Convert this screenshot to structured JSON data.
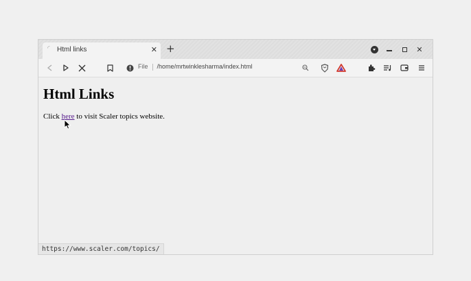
{
  "tab": {
    "title": "Html links",
    "favicon": "page-icon"
  },
  "window_controls": [
    "profile-menu-icon",
    "minimize-icon",
    "maximize-icon",
    "close-icon"
  ],
  "toolbar": {
    "address_label": "File",
    "address_url": "/home/mrtwinklesharma/index.html",
    "icons": [
      "back-icon",
      "forward-icon",
      "stop-icon",
      "bookmark-icon",
      "site-info-icon",
      "zoom-icon",
      "brave-shields-icon",
      "brave-rewards-icon",
      "extensions-icon",
      "playlist-icon",
      "wallet-icon",
      "menu-icon"
    ]
  },
  "page": {
    "heading": "Html Links",
    "text_before": "Click ",
    "link_text": "here",
    "text_after": " to visit Scaler topics website."
  },
  "status_bar": {
    "url": "https://www.scaler.com/topics/"
  },
  "colors": {
    "link": "#551a8b",
    "rewards_triangle": "#d13a2f",
    "background": "#efefef"
  }
}
